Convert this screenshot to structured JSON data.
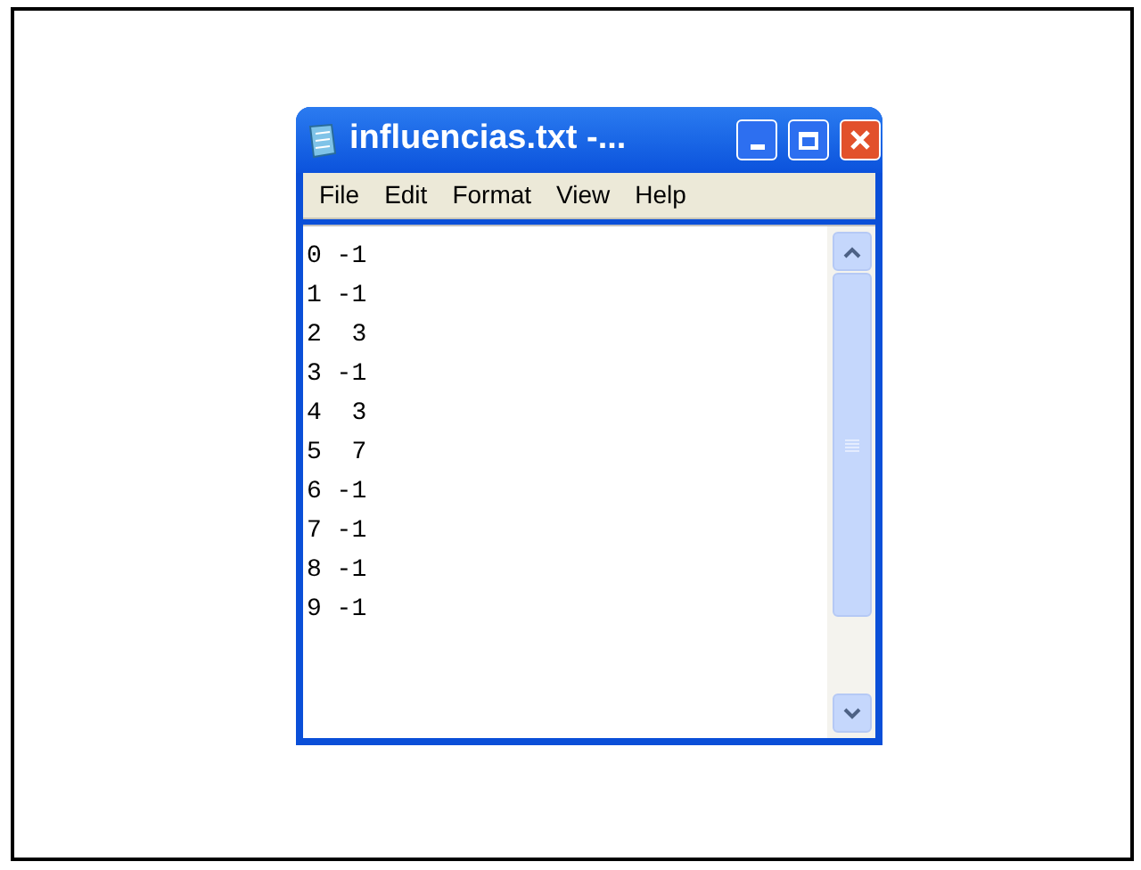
{
  "window": {
    "title": "influencias.txt -..."
  },
  "menu": [
    "File",
    "Edit",
    "Format",
    "View",
    "Help"
  ],
  "editor": {
    "lines": [
      "0 -1",
      "1 -1",
      "2  3",
      "3 -1",
      "4  3",
      "5  7",
      "6 -1",
      "7 -1",
      "8 -1",
      "9 -1"
    ]
  }
}
